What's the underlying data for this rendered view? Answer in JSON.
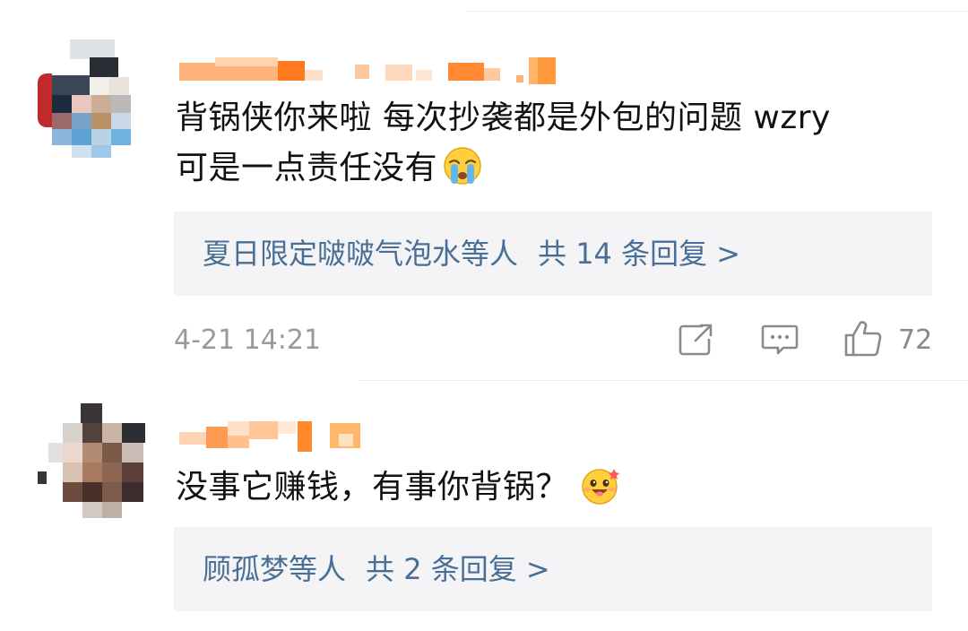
{
  "comments": [
    {
      "text_line1": "背锅侠你来啦 每次抄袭都是外包的问题 wzry",
      "text_line2": "可是一点责任没有",
      "emoji": "crying-face-icon",
      "reply_names": "夏日限定啵啵气泡水等人",
      "reply_count": "共 14 条回复 >",
      "time": "4-21 14:21",
      "likes": "72"
    },
    {
      "text": "没事它赚钱，有事你背锅？",
      "emoji": "shy-grinning-face-icon",
      "reply_names": "顾孤梦等人",
      "reply_count": "共 2 条回复 >"
    }
  ],
  "colors": {
    "link_blue": "#4a6f96",
    "meta_gray": "#9a9a9a",
    "reply_bg": "#f4f4f6",
    "username_orange": "#ff7a1f"
  }
}
